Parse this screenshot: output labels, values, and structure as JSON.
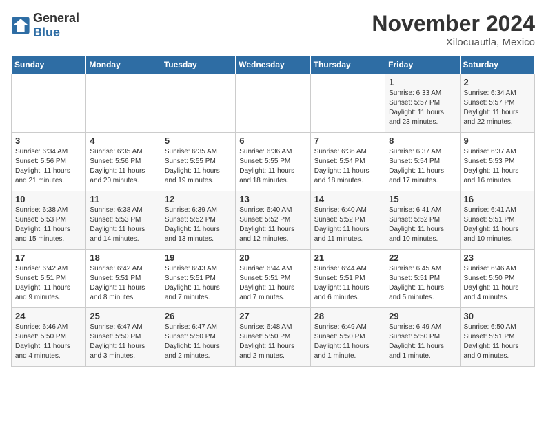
{
  "header": {
    "logo_general": "General",
    "logo_blue": "Blue",
    "month": "November 2024",
    "location": "Xilocuautla, Mexico"
  },
  "days_of_week": [
    "Sunday",
    "Monday",
    "Tuesday",
    "Wednesday",
    "Thursday",
    "Friday",
    "Saturday"
  ],
  "weeks": [
    [
      {
        "day": "",
        "info": ""
      },
      {
        "day": "",
        "info": ""
      },
      {
        "day": "",
        "info": ""
      },
      {
        "day": "",
        "info": ""
      },
      {
        "day": "",
        "info": ""
      },
      {
        "day": "1",
        "info": "Sunrise: 6:33 AM\nSunset: 5:57 PM\nDaylight: 11 hours and 23 minutes."
      },
      {
        "day": "2",
        "info": "Sunrise: 6:34 AM\nSunset: 5:57 PM\nDaylight: 11 hours and 22 minutes."
      }
    ],
    [
      {
        "day": "3",
        "info": "Sunrise: 6:34 AM\nSunset: 5:56 PM\nDaylight: 11 hours and 21 minutes."
      },
      {
        "day": "4",
        "info": "Sunrise: 6:35 AM\nSunset: 5:56 PM\nDaylight: 11 hours and 20 minutes."
      },
      {
        "day": "5",
        "info": "Sunrise: 6:35 AM\nSunset: 5:55 PM\nDaylight: 11 hours and 19 minutes."
      },
      {
        "day": "6",
        "info": "Sunrise: 6:36 AM\nSunset: 5:55 PM\nDaylight: 11 hours and 18 minutes."
      },
      {
        "day": "7",
        "info": "Sunrise: 6:36 AM\nSunset: 5:54 PM\nDaylight: 11 hours and 18 minutes."
      },
      {
        "day": "8",
        "info": "Sunrise: 6:37 AM\nSunset: 5:54 PM\nDaylight: 11 hours and 17 minutes."
      },
      {
        "day": "9",
        "info": "Sunrise: 6:37 AM\nSunset: 5:53 PM\nDaylight: 11 hours and 16 minutes."
      }
    ],
    [
      {
        "day": "10",
        "info": "Sunrise: 6:38 AM\nSunset: 5:53 PM\nDaylight: 11 hours and 15 minutes."
      },
      {
        "day": "11",
        "info": "Sunrise: 6:38 AM\nSunset: 5:53 PM\nDaylight: 11 hours and 14 minutes."
      },
      {
        "day": "12",
        "info": "Sunrise: 6:39 AM\nSunset: 5:52 PM\nDaylight: 11 hours and 13 minutes."
      },
      {
        "day": "13",
        "info": "Sunrise: 6:40 AM\nSunset: 5:52 PM\nDaylight: 11 hours and 12 minutes."
      },
      {
        "day": "14",
        "info": "Sunrise: 6:40 AM\nSunset: 5:52 PM\nDaylight: 11 hours and 11 minutes."
      },
      {
        "day": "15",
        "info": "Sunrise: 6:41 AM\nSunset: 5:52 PM\nDaylight: 11 hours and 10 minutes."
      },
      {
        "day": "16",
        "info": "Sunrise: 6:41 AM\nSunset: 5:51 PM\nDaylight: 11 hours and 10 minutes."
      }
    ],
    [
      {
        "day": "17",
        "info": "Sunrise: 6:42 AM\nSunset: 5:51 PM\nDaylight: 11 hours and 9 minutes."
      },
      {
        "day": "18",
        "info": "Sunrise: 6:42 AM\nSunset: 5:51 PM\nDaylight: 11 hours and 8 minutes."
      },
      {
        "day": "19",
        "info": "Sunrise: 6:43 AM\nSunset: 5:51 PM\nDaylight: 11 hours and 7 minutes."
      },
      {
        "day": "20",
        "info": "Sunrise: 6:44 AM\nSunset: 5:51 PM\nDaylight: 11 hours and 7 minutes."
      },
      {
        "day": "21",
        "info": "Sunrise: 6:44 AM\nSunset: 5:51 PM\nDaylight: 11 hours and 6 minutes."
      },
      {
        "day": "22",
        "info": "Sunrise: 6:45 AM\nSunset: 5:51 PM\nDaylight: 11 hours and 5 minutes."
      },
      {
        "day": "23",
        "info": "Sunrise: 6:46 AM\nSunset: 5:50 PM\nDaylight: 11 hours and 4 minutes."
      }
    ],
    [
      {
        "day": "24",
        "info": "Sunrise: 6:46 AM\nSunset: 5:50 PM\nDaylight: 11 hours and 4 minutes."
      },
      {
        "day": "25",
        "info": "Sunrise: 6:47 AM\nSunset: 5:50 PM\nDaylight: 11 hours and 3 minutes."
      },
      {
        "day": "26",
        "info": "Sunrise: 6:47 AM\nSunset: 5:50 PM\nDaylight: 11 hours and 2 minutes."
      },
      {
        "day": "27",
        "info": "Sunrise: 6:48 AM\nSunset: 5:50 PM\nDaylight: 11 hours and 2 minutes."
      },
      {
        "day": "28",
        "info": "Sunrise: 6:49 AM\nSunset: 5:50 PM\nDaylight: 11 hours and 1 minute."
      },
      {
        "day": "29",
        "info": "Sunrise: 6:49 AM\nSunset: 5:50 PM\nDaylight: 11 hours and 1 minute."
      },
      {
        "day": "30",
        "info": "Sunrise: 6:50 AM\nSunset: 5:51 PM\nDaylight: 11 hours and 0 minutes."
      }
    ]
  ]
}
